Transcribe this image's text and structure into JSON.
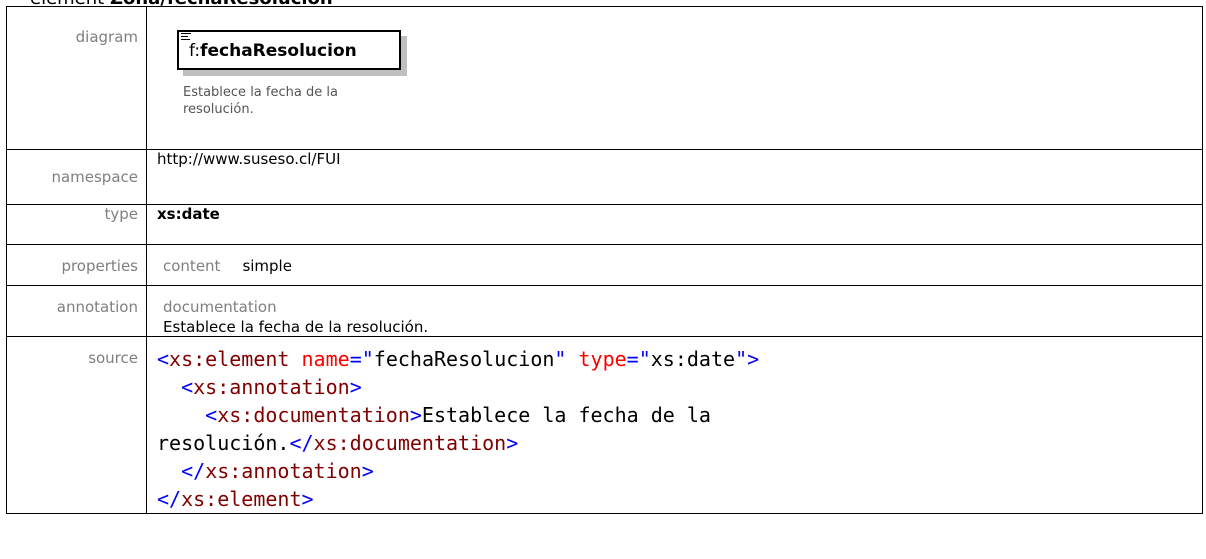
{
  "heading": {
    "prefix": "element ",
    "name": "Zona/fechaResolucion"
  },
  "rows": {
    "diagram": {
      "label": "diagram"
    },
    "namespace": {
      "label": "namespace",
      "value": "http://www.suseso.cl/FUI"
    },
    "type": {
      "label": "type",
      "value": "xs:date"
    },
    "properties": {
      "label": "properties",
      "key": "content",
      "value": "simple"
    },
    "annotation": {
      "label": "annotation",
      "key": "documentation",
      "value": "Establece la fecha de la resolución."
    },
    "source": {
      "label": "source"
    }
  },
  "diagram": {
    "prefix": "f:",
    "name": "fechaResolucion",
    "description": "Establece la fecha de la resolución."
  },
  "source_code": {
    "l1_open": "<",
    "l1_tag": "xs:element",
    "l1_attr1": " name",
    "l1_eq1": "=\"",
    "l1_val1": "fechaResolucion",
    "l1_q1": "\"",
    "l1_attr2": " type",
    "l1_eq2": "=\"",
    "l1_val2": "xs:date",
    "l1_close": "\">",
    "l2_open": "<",
    "l2_tag": "xs:annotation",
    "l2_close": ">",
    "l3_open": "<",
    "l3_tag": "xs:documentation",
    "l3_close": ">",
    "l3_text": "Establece la fecha de la",
    "l4_text": "resolución.",
    "l4_open": "</",
    "l4_tag": "xs:documentation",
    "l4_close": ">",
    "l5_open": "</",
    "l5_tag": "xs:annotation",
    "l5_close": ">",
    "l6_open": "</",
    "l6_tag": "xs:element",
    "l6_close": ">"
  },
  "colors": {
    "label": "#7f7f7f",
    "xml_punct": "#0000ff",
    "xml_tag": "#800000",
    "xml_attr": "#ff0000"
  }
}
